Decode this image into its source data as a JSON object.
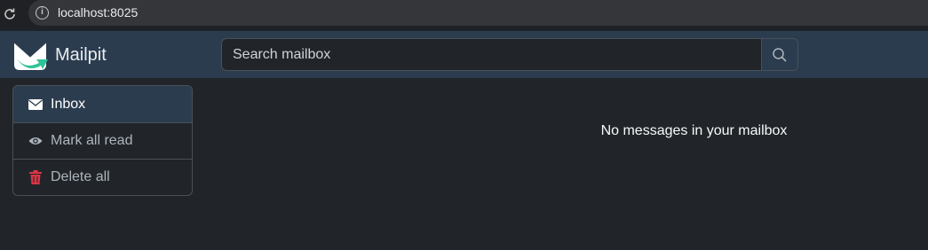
{
  "browser": {
    "url": "localhost:8025",
    "reload_icon": "reload-icon",
    "info_icon": "info-icon"
  },
  "navbar": {
    "brand_name": "Mailpit",
    "logo_icon": "mailpit-logo-icon",
    "colors": {
      "background": "#2b3c4f",
      "logo_green": "#2fc398"
    }
  },
  "search": {
    "placeholder": "Search mailbox",
    "button_icon": "search-icon"
  },
  "sidebar": {
    "items": [
      {
        "label": "Inbox",
        "icon": "envelope-icon",
        "active": true
      },
      {
        "label": "Mark all read",
        "icon": "eye-icon",
        "active": false
      },
      {
        "label": "Delete all",
        "icon": "trash-icon",
        "active": false,
        "icon_color": "#dc3545"
      }
    ]
  },
  "main": {
    "empty_message": "No messages in your mailbox"
  }
}
